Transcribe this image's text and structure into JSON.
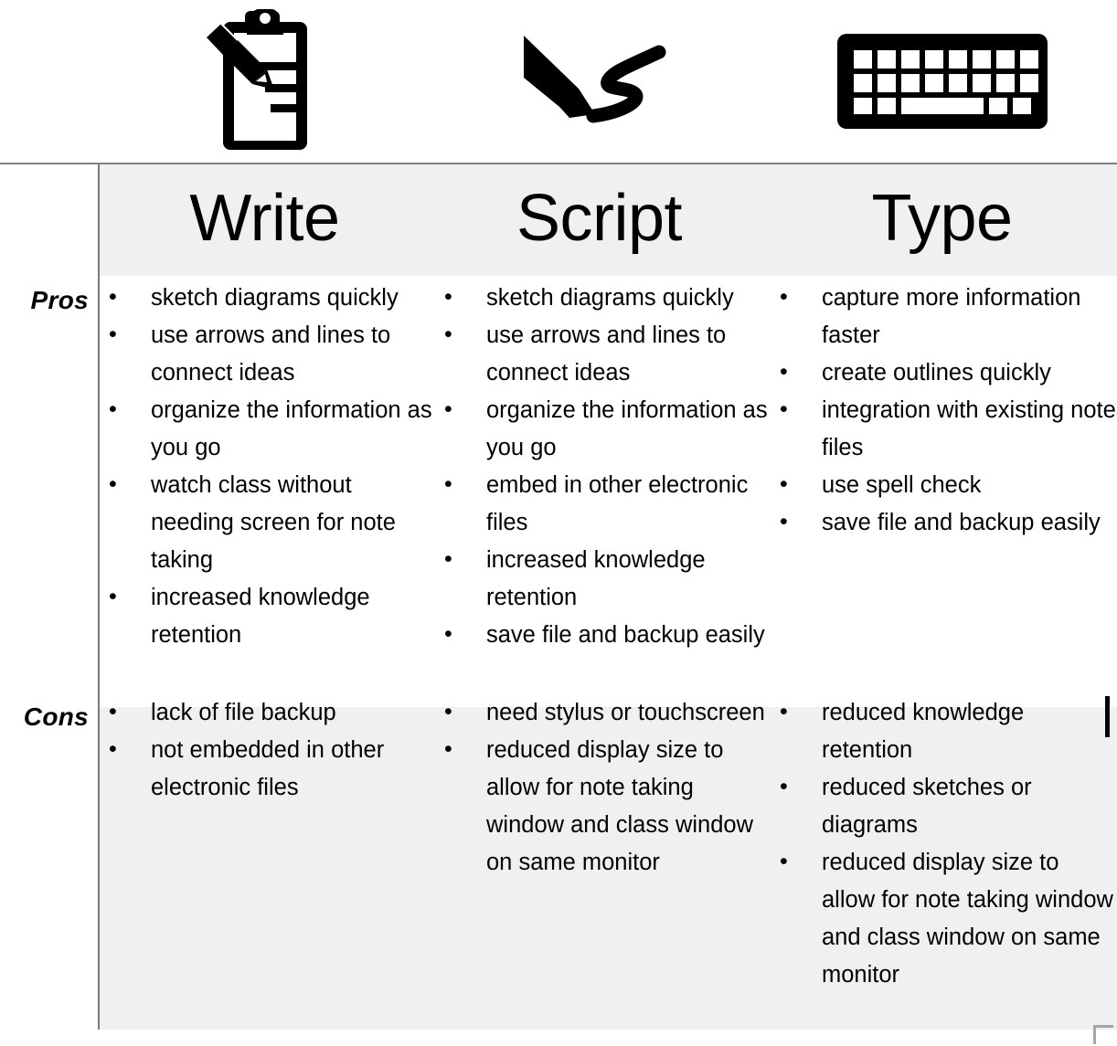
{
  "icons": [
    {
      "name": "clipboard-pencil-icon",
      "label": "clipboard with pencil"
    },
    {
      "name": "stylus-script-icon",
      "label": "stylus writing script"
    },
    {
      "name": "keyboard-icon",
      "label": "keyboard"
    }
  ],
  "table": {
    "columns": [
      {
        "header": "Write"
      },
      {
        "header": "Script"
      },
      {
        "header": "Type"
      }
    ],
    "row_labels": {
      "pros": "Pros",
      "cons": "Cons"
    },
    "pros": {
      "write": [
        "sketch diagrams quickly",
        "use arrows and lines to connect ideas",
        "organize the information as you go",
        "watch class without needing screen for note taking",
        "increased knowledge retention"
      ],
      "script": [
        "sketch diagrams quickly",
        "use arrows and lines to connect ideas",
        "organize the information as you go",
        "embed in other electronic files",
        "increased knowledge retention",
        "save file and backup easily"
      ],
      "type": [
        "capture more information faster",
        "create outlines quickly",
        "integration with existing note files",
        "use spell check",
        "save file and backup easily"
      ]
    },
    "cons": {
      "write": [
        "lack of file backup",
        "not embedded in other electronic files"
      ],
      "script": [
        "need stylus or touchscreen",
        "reduced display size to allow for note taking window and class window on same monitor"
      ],
      "type": [
        "reduced knowledge retention",
        "reduced sketches or diagrams",
        "reduced display size to allow for note taking window and class window on same monitor"
      ]
    }
  },
  "colors": {
    "header_band": "#f0f0f0",
    "cons_band": "#f0f0f0",
    "border": "#7a7a7a",
    "text": "#000000",
    "handle": "#a6a6a6"
  }
}
